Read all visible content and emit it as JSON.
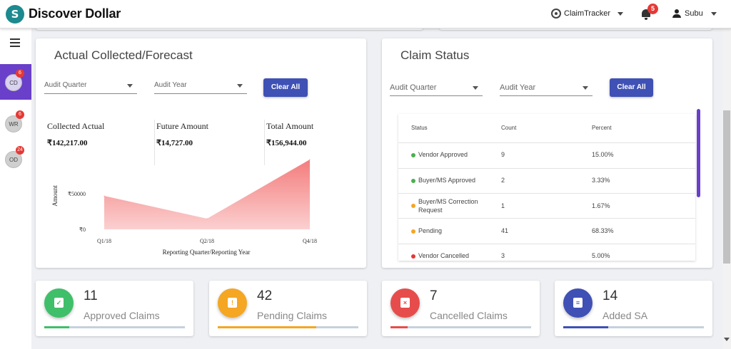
{
  "app": {
    "brand": "Discover Dollar",
    "logo_glyph": "S",
    "tracker_label": "ClaimTracker",
    "notifications_count": "5",
    "user_name": "Subu"
  },
  "sidebar": {
    "items": [
      {
        "abbr": "CD",
        "badge": "6",
        "active": true
      },
      {
        "abbr": "WR",
        "badge": "6",
        "active": false
      },
      {
        "abbr": "OD",
        "badge": "24",
        "active": false
      }
    ]
  },
  "forecast": {
    "title": "Actual Collected/Forecast",
    "filter_quarter": "Audit Quarter",
    "filter_year": "Audit Year",
    "clear_label": "Clear All",
    "collected_label": "Collected Actual",
    "collected_value": "₹142,217.00",
    "future_label": "Future Amount",
    "future_value": "₹14,727.00",
    "total_label": "Total Amount",
    "total_value": "₹156,944.00"
  },
  "chart_data": {
    "type": "area",
    "x": [
      "Q1/18",
      "Q2/18",
      "Q4/18"
    ],
    "values": [
      47000,
      15000,
      98000
    ],
    "ylabel": "Amount",
    "xlabel": "Reporting Quarter/Reporting Year",
    "y_ticks": [
      "₹0",
      "₹50000"
    ],
    "ylim": [
      0,
      100000
    ],
    "grid": false,
    "color": "#f47c7c"
  },
  "claim_status": {
    "title": "Claim Status",
    "filter_quarter": "Audit Quarter",
    "filter_year": "Audit Year",
    "clear_label": "Clear All",
    "columns": [
      "Status",
      "Count",
      "Percent"
    ],
    "rows": [
      {
        "status": "Vendor Approved",
        "count": "9",
        "percent": "15.00%",
        "color": "#4caf50"
      },
      {
        "status": "Buyer/MS Approved",
        "count": "2",
        "percent": "3.33%",
        "color": "#4caf50"
      },
      {
        "status": "Buyer/MS Correction Request",
        "count": "1",
        "percent": "1.67%",
        "color": "#f5a623"
      },
      {
        "status": "Pending",
        "count": "41",
        "percent": "68.33%",
        "color": "#f5a623"
      },
      {
        "status": "Vendor Cancelled",
        "count": "3",
        "percent": "5.00%",
        "color": "#e53935"
      }
    ]
  },
  "stats": [
    {
      "count": "11",
      "label": "Approved Claims",
      "color": "#3fbf6a",
      "fraction": 0.18,
      "icon": "check-icon",
      "glyph": "✓"
    },
    {
      "count": "42",
      "label": "Pending Claims",
      "color": "#f5a623",
      "fraction": 0.7,
      "icon": "pending-icon",
      "glyph": "!"
    },
    {
      "count": "7",
      "label": "Cancelled Claims",
      "color": "#e74c4c",
      "fraction": 0.12,
      "icon": "cancel-icon",
      "glyph": "×"
    },
    {
      "count": "14",
      "label": "Added SA",
      "color": "#3f51b5",
      "fraction": 0.32,
      "icon": "clipboard-icon",
      "glyph": "≡"
    }
  ]
}
